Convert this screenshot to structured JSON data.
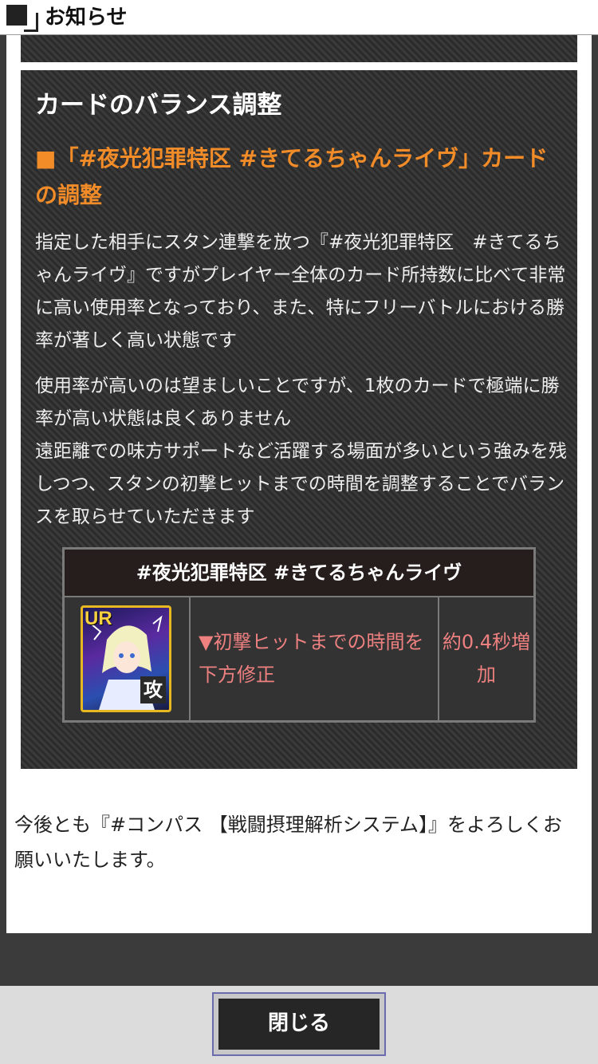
{
  "header": {
    "title": "お知らせ"
  },
  "section": {
    "title": "カードのバランス調整",
    "subtitle": "■「#夜光犯罪特区 #きてるちゃんライヴ」カードの調整",
    "paragraph1": "指定した相手にスタン連撃を放つ『#夜光犯罪特区　#きてるちゃんライヴ』ですがプレイヤー全体のカード所持数に比べて非常に高い使用率となっており、また、特にフリーバトルにおける勝率が著しく高い状態です",
    "paragraph2": "使用率が高いのは望ましいことですが、1枚のカードで極端に勝率が高い状態は良くありません\n遠距離での味方サポートなど活躍する場面が多いという強みを残しつつ、スタンの初撃ヒットまでの時間を調整することでバランスを取らせていただきます",
    "table": {
      "header": "#夜光犯罪特区 #きてるちゃんライヴ",
      "card_rank": "UR",
      "card_role_icon": "攻",
      "change": "▼初撃ヒットまでの時間を下方修正",
      "amount": "約0.4秒増加"
    }
  },
  "closing": "今後とも『#コンパス 【戦闘摂理解析システム】』をよろしくお願いいたします。",
  "footer": {
    "close_label": "閉じる"
  },
  "colors": {
    "accent_orange": "#f28c28",
    "change_pink": "#ee8080",
    "stripe_dark": "#2e2e2e"
  }
}
